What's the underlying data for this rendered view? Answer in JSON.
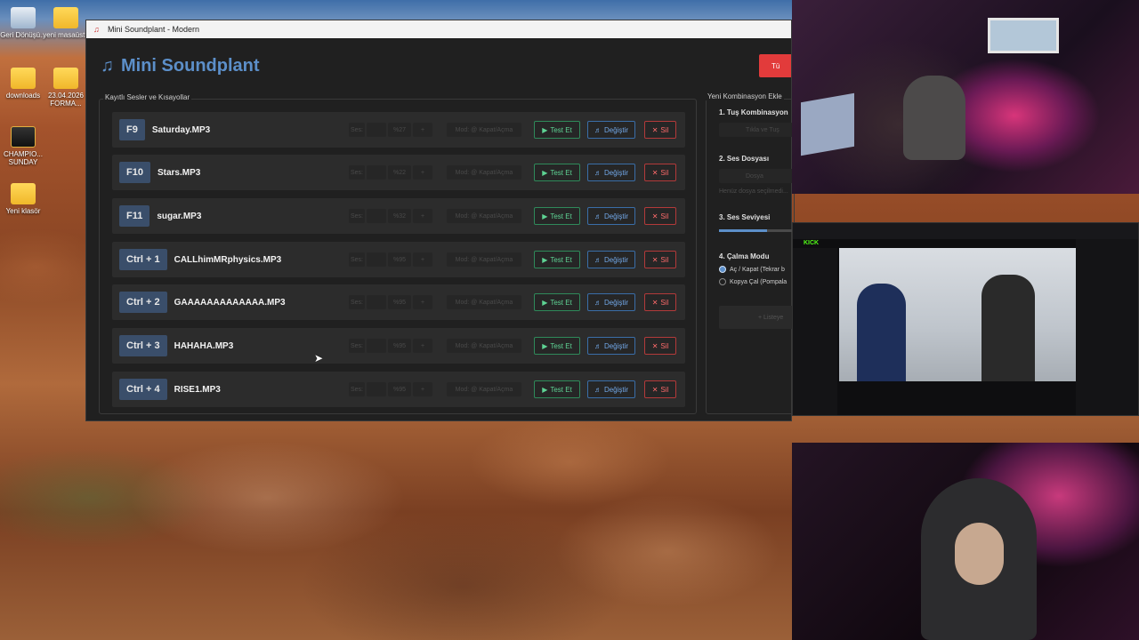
{
  "window": {
    "title": "Mini Soundplant - Modern"
  },
  "app": {
    "title": "Mini Soundplant",
    "stop_button": "Tü"
  },
  "desktop_icons": [
    {
      "label": "Geri Dönüşü...",
      "icon": "recycle-bin-icon"
    },
    {
      "label": "yeni masaüstü",
      "icon": "folder-icon"
    },
    {
      "label": "downloads",
      "icon": "folder-icon"
    },
    {
      "label": "23.04.2026 FORMA...",
      "icon": "folder-icon"
    },
    {
      "label": "CHAMPIO... SUNDAY",
      "icon": "app-icon"
    },
    {
      "label": "Yeni klasör",
      "icon": "folder-icon"
    }
  ],
  "saved_sounds": {
    "title": "Kayıtlı Sesler ve Kısayollar",
    "volume_label": "Ses:",
    "mode_label": "Mod: @ Kapat/Açma",
    "test_label": "Test Et",
    "change_label": "Değiştir",
    "delete_label": "Sil",
    "rows": [
      {
        "key": "F9",
        "file": "Saturday.MP3",
        "volume": "%27"
      },
      {
        "key": "F10",
        "file": "Stars.MP3",
        "volume": "%22"
      },
      {
        "key": "F11",
        "file": "sugar.MP3",
        "volume": "%32"
      },
      {
        "key": "Ctrl + 1",
        "file": "CALLhimMRphysics.MP3",
        "volume": "%95"
      },
      {
        "key": "Ctrl + 2",
        "file": "GAAAAAAAAAAAAA.MP3",
        "volume": "%95"
      },
      {
        "key": "Ctrl + 3",
        "file": "HAHAHA.MP3",
        "volume": "%95"
      },
      {
        "key": "Ctrl + 4",
        "file": "RISE1.MP3",
        "volume": "%95"
      }
    ]
  },
  "new_combo": {
    "title": "Yeni Kombinasyon Ekle",
    "step1": "1. Tuş Kombinasyon",
    "step1_button": "Tıkla ve Tuş",
    "step2": "2. Ses Dosyası",
    "step2_button": "Dosya",
    "step2_hint": "Henüz dosya seçilmedi...",
    "step3": "3. Ses Seviyesi",
    "volume_level": 0.6,
    "step4": "4. Çalma Modu",
    "mode_options": [
      "Aç / Kapat (Tekrar b",
      "Kopya Çal (Pompala"
    ],
    "add_button": "Listeye"
  },
  "stream": {
    "brand": "KICK"
  }
}
